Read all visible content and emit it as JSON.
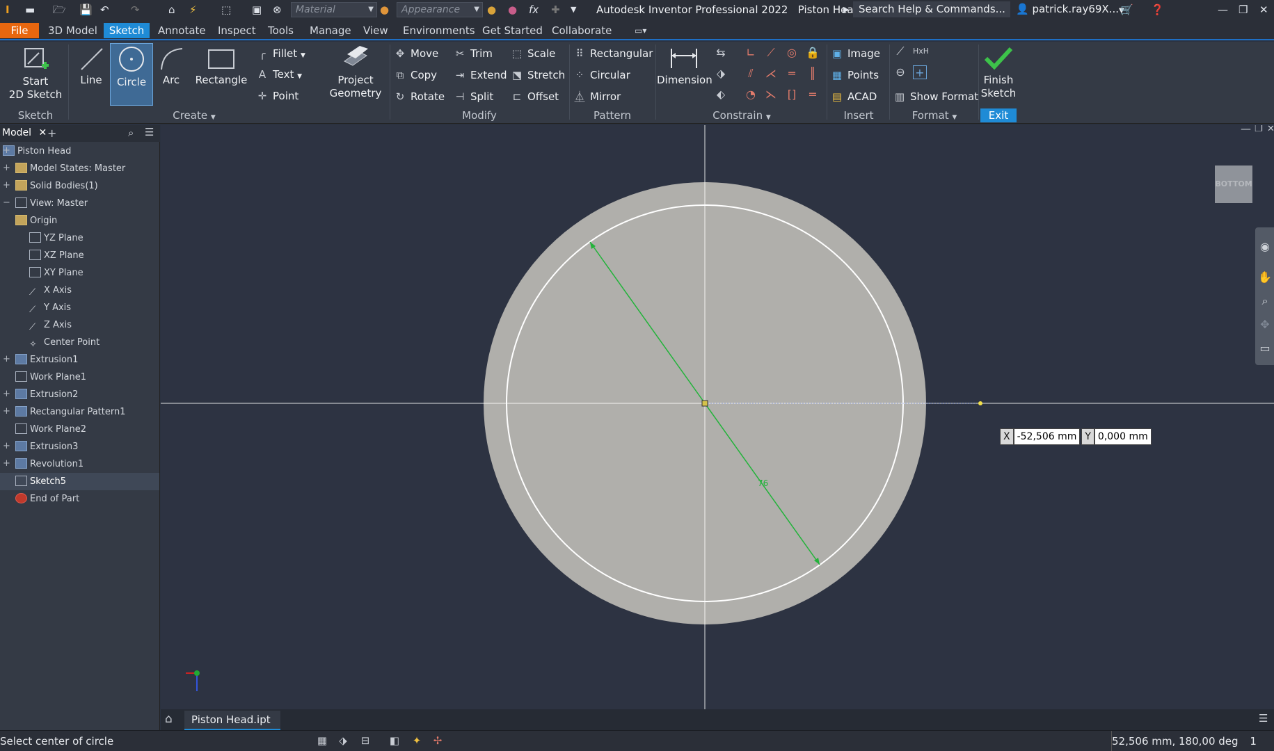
{
  "titlebar": {
    "app_title": "Autodesk Inventor Professional 2022",
    "doc_title": "Piston Head",
    "search_placeholder": "Search Help & Commands...",
    "user": "patrick.ray69X...",
    "material": "Material",
    "appearance": "Appearance"
  },
  "menu": {
    "file": "File",
    "tabs": [
      "3D Model",
      "Sketch",
      "Annotate",
      "Inspect",
      "Tools",
      "Manage",
      "View",
      "Environments",
      "Get Started",
      "Collaborate"
    ],
    "active": "Sketch"
  },
  "ribbon": {
    "sketch_group": {
      "start": "Start\n2D Sketch",
      "label": "Sketch"
    },
    "create": {
      "line": "Line",
      "circle": "Circle",
      "arc": "Arc",
      "rectangle": "Rectangle",
      "fillet": "Fillet",
      "text": "Text",
      "point": "Point",
      "label": "Create"
    },
    "project": {
      "line1": "Project",
      "line2": "Geometry"
    },
    "modify": {
      "move": "Move",
      "copy": "Copy",
      "rotate": "Rotate",
      "trim": "Trim",
      "extend": "Extend",
      "split": "Split",
      "scale": "Scale",
      "stretch": "Stretch",
      "offset": "Offset",
      "label": "Modify"
    },
    "pattern": {
      "rectangular": "Rectangular",
      "circular": "Circular",
      "mirror": "Mirror",
      "label": "Pattern"
    },
    "constrain": {
      "dimension": "Dimension",
      "label": "Constrain"
    },
    "insert": {
      "image": "Image",
      "points": "Points",
      "acad": "ACAD",
      "label": "Insert"
    },
    "format": {
      "show_format": "Show Format",
      "label": "Format"
    },
    "finish": {
      "line1": "Finish",
      "line2": "Sketch",
      "label": "Exit"
    }
  },
  "browser": {
    "tab": "Model",
    "items": [
      "Piston Head",
      "Model States: Master",
      "Solid Bodies(1)",
      "View: Master",
      "Origin",
      "YZ Plane",
      "XZ Plane",
      "XY Plane",
      "X Axis",
      "Y Axis",
      "Z Axis",
      "Center Point",
      "Extrusion1",
      "Work Plane1",
      "Extrusion2",
      "Rectangular Pattern1",
      "Work Plane2",
      "Extrusion3",
      "Revolution1",
      "Sketch5",
      "End of Part"
    ]
  },
  "canvas": {
    "viewcube": "BOTTOM",
    "dimension_label": "76",
    "coord_x_tag": "X",
    "coord_x": "-52,506 mm",
    "coord_y_tag": "Y",
    "coord_y": "0,000 mm"
  },
  "doc_tab": "Piston Head.ipt",
  "status": {
    "prompt": "Select center of circle",
    "readout": "52,506 mm, 180,00 deg",
    "count1": "1",
    "count2": "1"
  },
  "colors": {
    "accent": "#1f8bd6",
    "file_tab": "#e8670f",
    "canvas_bg": "#2d3342",
    "part_face": "#b0afab",
    "dimension": "#22b33a"
  }
}
